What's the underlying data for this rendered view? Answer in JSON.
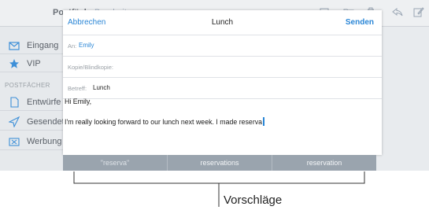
{
  "background": {
    "sidebar_title": "Postfächer",
    "sidebar_edit": "Bearbeiten",
    "sidebar_items": [
      {
        "label": "Eingang",
        "icon": "inbox-icon"
      },
      {
        "label": "VIP",
        "icon": "star-icon"
      }
    ],
    "section_header": "POSTFÄCHER",
    "section_items": [
      {
        "label": "Entwürfe",
        "icon": "draft-icon"
      },
      {
        "label": "Gesendet",
        "icon": "sent-icon"
      },
      {
        "label": "Werbung",
        "icon": "junk-icon"
      }
    ],
    "toolbar_icons": [
      "flag-icon",
      "folder-icon",
      "trash-icon",
      "reply-icon",
      "compose-icon"
    ]
  },
  "compose": {
    "cancel_label": "Abbrechen",
    "title": "Lunch",
    "send_label": "Senden",
    "to_label": "An:",
    "to_value": "Emily",
    "cc_label": "Kopie/Blindkopie:",
    "subject_label": "Betreff:",
    "subject_value": "Lunch",
    "body_line1": "Hi Emily,",
    "body_line2": "I'm really looking forward to our lunch next week. I made reserva"
  },
  "suggestions": [
    "\"reserva\"",
    "reservations",
    "reservation"
  ],
  "annotation": {
    "label": "Vorschläge"
  },
  "colors": {
    "accent": "#2a86d6",
    "suggestion_bar": "#9aa4ae",
    "sidebar_bg": "#e6e9ec"
  }
}
